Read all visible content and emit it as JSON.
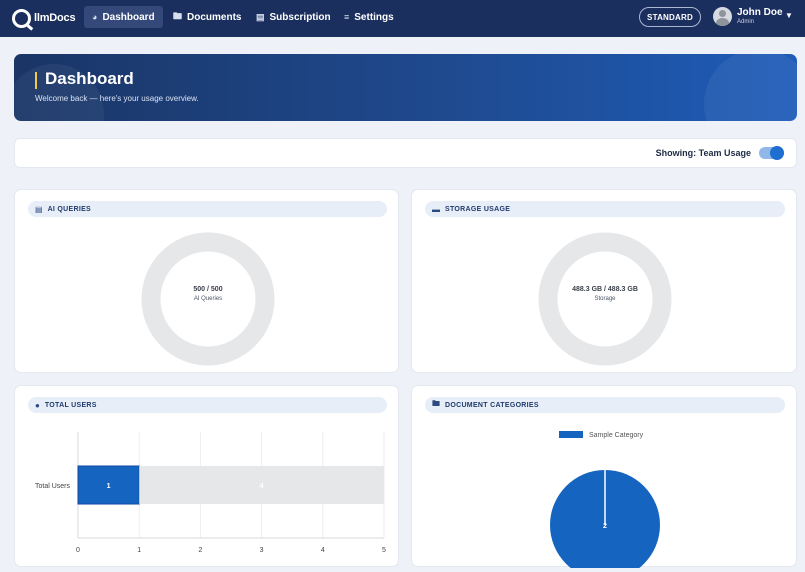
{
  "app": {
    "logo_text": "llmDocs"
  },
  "nav": {
    "items": [
      {
        "label": "Dashboard",
        "icon": "dashboard-icon"
      },
      {
        "label": "Documents",
        "icon": "folder-icon"
      },
      {
        "label": "Subscription",
        "icon": "receipt-icon"
      },
      {
        "label": "Settings",
        "icon": "sliders-icon"
      }
    ],
    "plan_badge": "STANDARD",
    "user": {
      "name": "John Doe",
      "role": "Admin"
    }
  },
  "hero": {
    "title": "Dashboard",
    "subtitle": "Welcome back — here's your usage overview."
  },
  "filter": {
    "label": "Showing: Team Usage",
    "toggle_on": true
  },
  "cards": {
    "ai_queries": {
      "title": "AI QUERIES",
      "main": "500 / 500",
      "sub": "AI Queries",
      "used": 500,
      "limit": 500
    },
    "storage": {
      "title": "STORAGE USAGE",
      "main": "488.3 GB / 488.3 GB",
      "sub": "Storage",
      "used": 488.3,
      "limit": 488.3
    },
    "total_users": {
      "title": "TOTAL USERS"
    },
    "doc_categories": {
      "title": "DOCUMENT CATEGORIES"
    }
  },
  "colors": {
    "accent": "#1f6fd0",
    "bar": "#1565c0",
    "track": "#e6e7e9",
    "nav": "#1b2f5e"
  },
  "chart_data": [
    {
      "type": "bar",
      "orientation": "horizontal",
      "categories": [
        "Total Users"
      ],
      "series": [
        {
          "values": [
            1
          ]
        },
        {
          "values": [
            4
          ]
        }
      ],
      "data_labels": [
        "1",
        "4"
      ],
      "xlim": [
        0,
        5
      ],
      "xticks": [
        "0",
        "1",
        "2",
        "3",
        "4",
        "5"
      ],
      "grid": true
    },
    {
      "type": "pie",
      "legend": [
        "Sample Category"
      ],
      "legend_position": "top",
      "slices": [
        {
          "label": "Sample Category",
          "value": 2
        }
      ],
      "data_labels": [
        "2"
      ]
    }
  ]
}
